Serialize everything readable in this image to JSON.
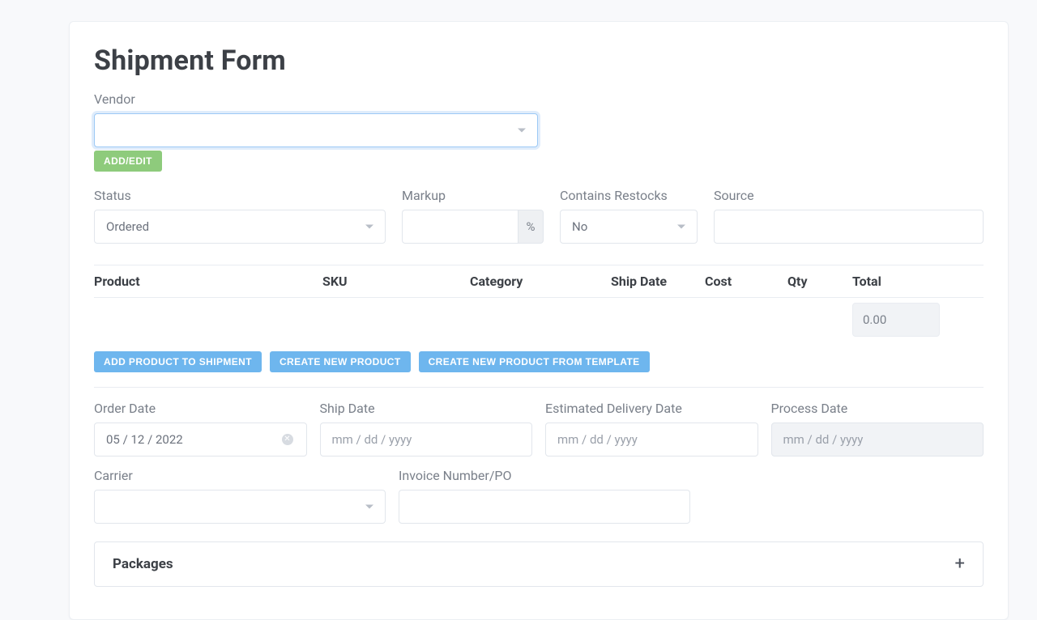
{
  "title": "Shipment Form",
  "vendor": {
    "label": "Vendor",
    "value": "",
    "add_edit_label": "ADD/EDIT"
  },
  "status": {
    "label": "Status",
    "value": "Ordered"
  },
  "markup": {
    "label": "Markup",
    "value": "",
    "addon": "%"
  },
  "restocks": {
    "label": "Contains Restocks",
    "value": "No"
  },
  "source": {
    "label": "Source",
    "value": ""
  },
  "table": {
    "headers": {
      "product": "Product",
      "sku": "SKU",
      "category": "Category",
      "ship": "Ship Date",
      "cost": "Cost",
      "qty": "Qty",
      "total": "Total"
    },
    "total_value": "0.00"
  },
  "buttons": {
    "add_product": "ADD PRODUCT TO SHIPMENT",
    "create_product": "CREATE NEW PRODUCT",
    "from_template": "CREATE NEW PRODUCT FROM TEMPLATE"
  },
  "dates": {
    "order": {
      "label": "Order Date",
      "value": "05 / 12 / 2022"
    },
    "ship": {
      "label": "Ship Date",
      "placeholder": "mm / dd / yyyy"
    },
    "edd": {
      "label": "Estimated Delivery Date",
      "placeholder": "mm / dd / yyyy"
    },
    "process": {
      "label": "Process Date",
      "placeholder": "mm / dd / yyyy"
    }
  },
  "carrier": {
    "label": "Carrier",
    "value": ""
  },
  "invoice": {
    "label": "Invoice Number/PO",
    "value": ""
  },
  "packages_label": "Packages"
}
